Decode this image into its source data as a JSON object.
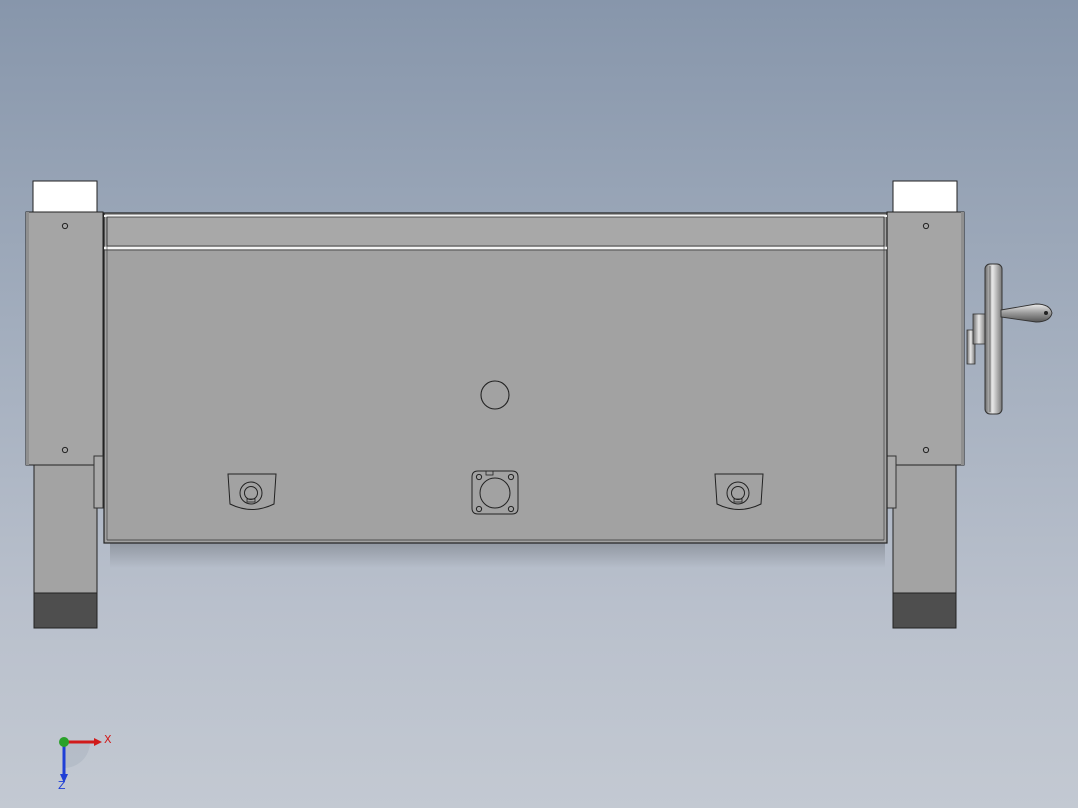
{
  "view": {
    "background_top": "#8796ab",
    "background_bottom": "#c3c9d2"
  },
  "model": {
    "body_color": "#a2a2a2",
    "frame_color": "#a7a7a7",
    "block_white": "#ffffff",
    "foot_dark": "#4e4e4e",
    "edge_color": "#222222"
  },
  "triad": {
    "x_label": "X",
    "z_label": "Z",
    "x_color": "#d11a1a",
    "y_color": "#2aa12a",
    "z_color": "#1f3fd6"
  }
}
